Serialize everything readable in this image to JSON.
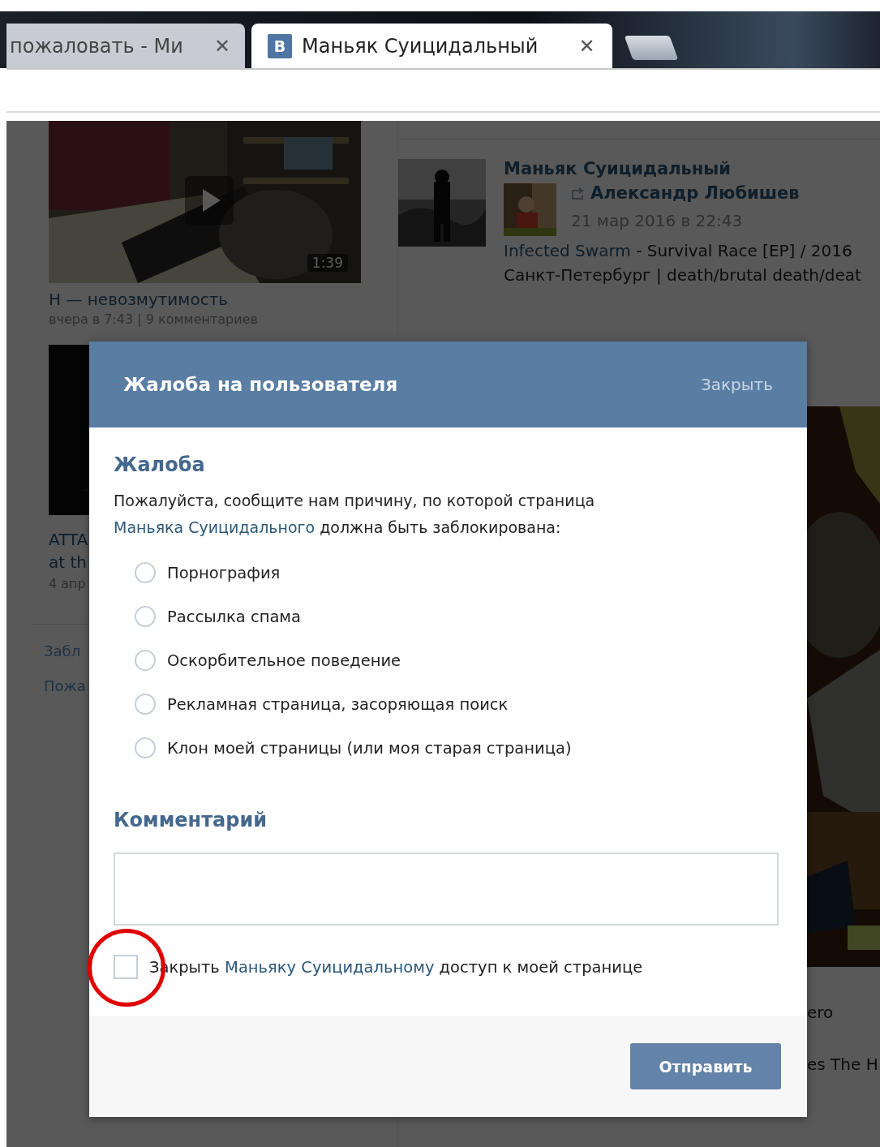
{
  "browser": {
    "tabs": [
      {
        "title": "пожаловать - Ми",
        "close": "✕",
        "selected": false
      },
      {
        "logo": "B",
        "title": "Маньяк Суицидальный",
        "close": "✕",
        "selected": true
      }
    ]
  },
  "page": {
    "video": {
      "duration": "1:39",
      "title": "Н — невозмутимость",
      "meta": "вчера в 7:43 | 9 комментариев"
    },
    "video2": {
      "title_lines": [
        "ATTA",
        "at th"
      ],
      "meta": "4 апр"
    },
    "left_links": [
      "Забл",
      "Пожа"
    ],
    "post": {
      "author": "Маньяк Суицидальный",
      "reposted_from": "Александр Любишев",
      "date": "21 мар 2016 в 22:43",
      "artist": "Infected Swarm",
      "release": " - Survival Race [EP] / 2016",
      "info": "Санкт-Петербург | death/brutal death/deat"
    },
    "right_texts": [
      "ero",
      "es The H"
    ]
  },
  "dialog": {
    "title": "Жалоба на пользователя",
    "close": "Закрыть",
    "section": "Жалоба",
    "prompt": {
      "before": "Пожалуйста, сообщите нам причину, по которой страница ",
      "link": "Маньяка Суицидального",
      "after": " должна быть заблокирована:"
    },
    "options": [
      {
        "label": "Порнография",
        "selected": false
      },
      {
        "label": "Рассылка спама",
        "selected": false
      },
      {
        "label": "Оскорбительное поведение",
        "selected": false
      },
      {
        "label": "Рекламная страница, засоряющая поиск",
        "selected": false
      },
      {
        "label": "Клон моей страницы (или моя старая страница)",
        "selected": false
      }
    ],
    "comment_heading": "Комментарий",
    "block": {
      "before": "Закрыть ",
      "link": "Маньяку Суицидальному",
      "after": " доступ к моей странице",
      "checked": false
    },
    "submit": "Отправить"
  }
}
